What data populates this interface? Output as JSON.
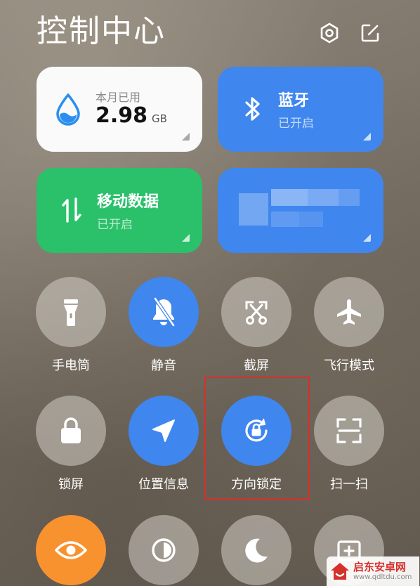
{
  "header": {
    "title": "控制中心",
    "settings_icon": "hexagon-settings-icon",
    "edit_icon": "edit-icon"
  },
  "tiles": {
    "data_usage": {
      "label": "本月已用",
      "value": "2.98",
      "unit": "GB",
      "icon": "water-drop-icon"
    },
    "bluetooth": {
      "title": "蓝牙",
      "status": "已开启",
      "icon": "bluetooth-icon"
    },
    "mobile_data": {
      "title": "移动数据",
      "status": "已开启",
      "icon": "data-transfer-arrows-icon"
    },
    "wifi": {
      "title": "",
      "status": "",
      "icon": "wifi-pixelated"
    }
  },
  "toggles": [
    {
      "label": "手电筒",
      "icon": "flashlight-icon",
      "state": "off"
    },
    {
      "label": "静音",
      "icon": "bell-slash-icon",
      "state": "on"
    },
    {
      "label": "截屏",
      "icon": "scissors-screenshot-icon",
      "state": "off"
    },
    {
      "label": "飞行模式",
      "icon": "airplane-icon",
      "state": "off"
    },
    {
      "label": "锁屏",
      "icon": "lock-icon",
      "state": "off"
    },
    {
      "label": "位置信息",
      "icon": "location-arrow-icon",
      "state": "on"
    },
    {
      "label": "方向锁定",
      "icon": "rotation-lock-icon",
      "state": "on"
    },
    {
      "label": "扫一扫",
      "icon": "scan-icon",
      "state": "off"
    },
    {
      "label": "",
      "icon": "eye-icon",
      "state": "orange"
    },
    {
      "label": "",
      "icon": "contrast-icon",
      "state": "off"
    },
    {
      "label": "",
      "icon": "moon-icon",
      "state": "off"
    },
    {
      "label": "",
      "icon": "add-window-icon",
      "state": "off"
    }
  ],
  "colors": {
    "accent_blue": "#3f86ee",
    "accent_green": "#2bc06a",
    "accent_orange": "#f8922f",
    "highlight_red": "#d6302b"
  },
  "watermark": {
    "name": "启东安卓网",
    "url": "www.qdltdu.com"
  }
}
